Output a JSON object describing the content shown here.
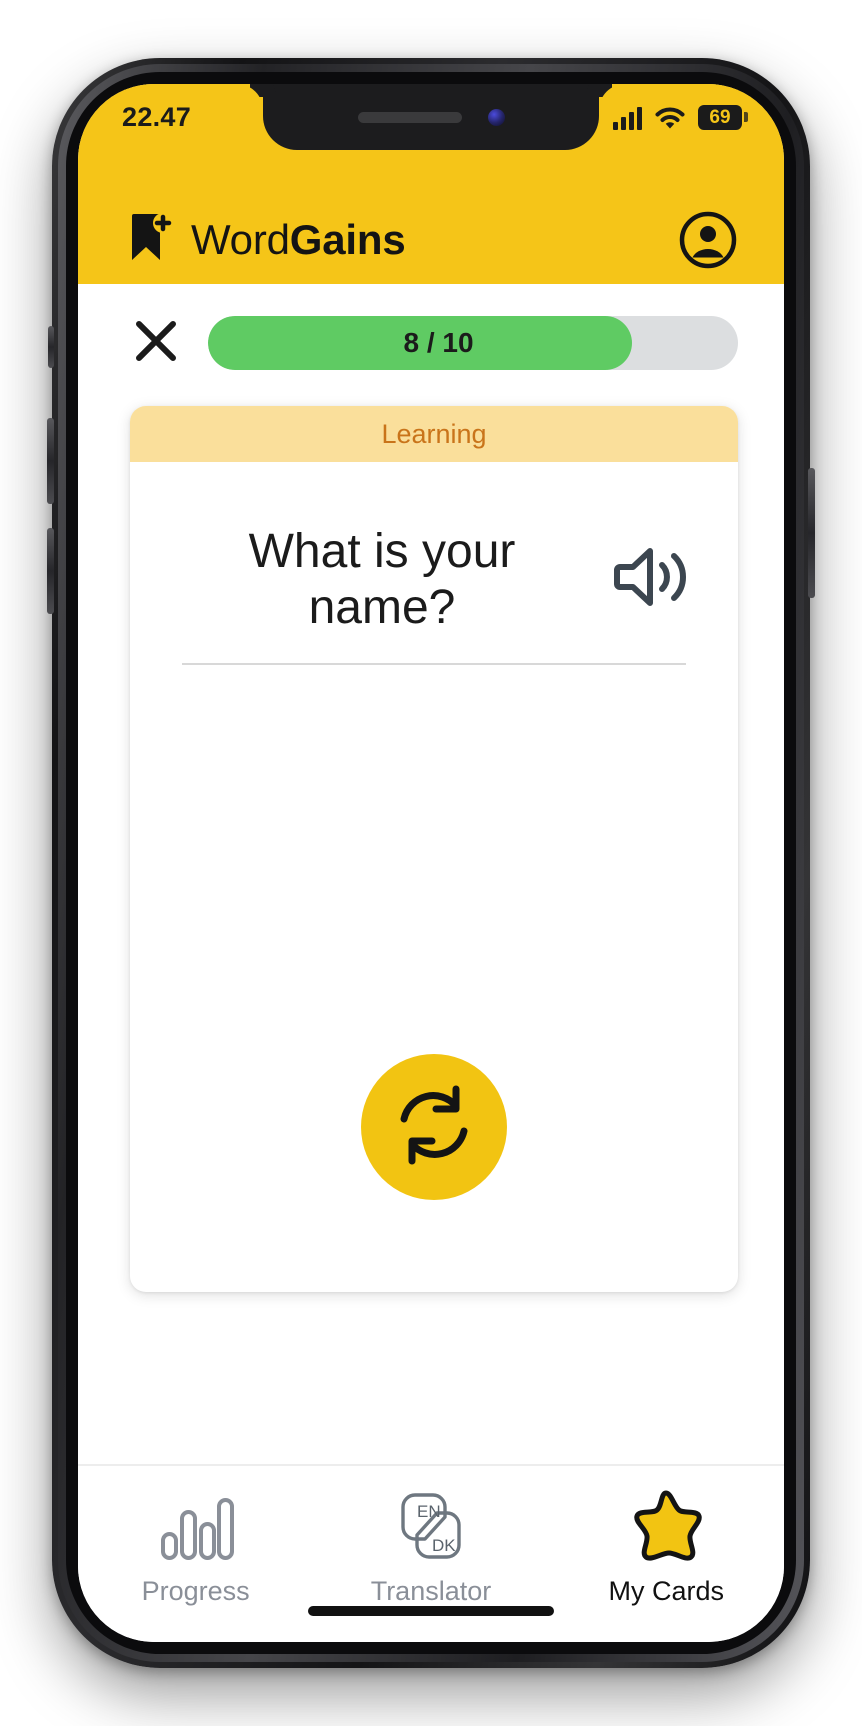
{
  "status_bar": {
    "time": "22.47",
    "cellular_icon": "cellular-signal-icon",
    "wifi_icon": "wifi-icon",
    "battery_level": "69",
    "battery_icon": "battery-icon"
  },
  "header": {
    "logo_icon": "bookmark-plus-icon",
    "brand_first": "Word",
    "brand_second": "Gains",
    "account_icon": "account-circle-icon"
  },
  "session": {
    "close_icon": "close-x-icon",
    "progress_label": "8 / 10",
    "progress_current": 8,
    "progress_total": 10,
    "progress_percent": 80,
    "progress_fill_color": "#5FCB63",
    "progress_track_color": "#DCDEE0"
  },
  "card": {
    "status_label": "Learning",
    "status_bg_color": "#FADF9B",
    "status_text_color": "#C9741A",
    "question": "What is your name?",
    "speaker_icon": "speaker-volume-icon",
    "flip_icon": "refresh-flip-icon",
    "flip_bg_color": "#F2C412"
  },
  "bottom_nav": {
    "items": [
      {
        "label": "Progress",
        "icon": "bar-chart-icon",
        "active": false
      },
      {
        "label": "Translator",
        "icon": "translate-en-dk-icon",
        "active": false
      },
      {
        "label": "My Cards",
        "icon": "star-icon",
        "active": true
      }
    ]
  },
  "theme": {
    "brand_yellow": "#F5C518",
    "accent_gold": "#F2C412",
    "text_dark": "#1b1b1b"
  }
}
